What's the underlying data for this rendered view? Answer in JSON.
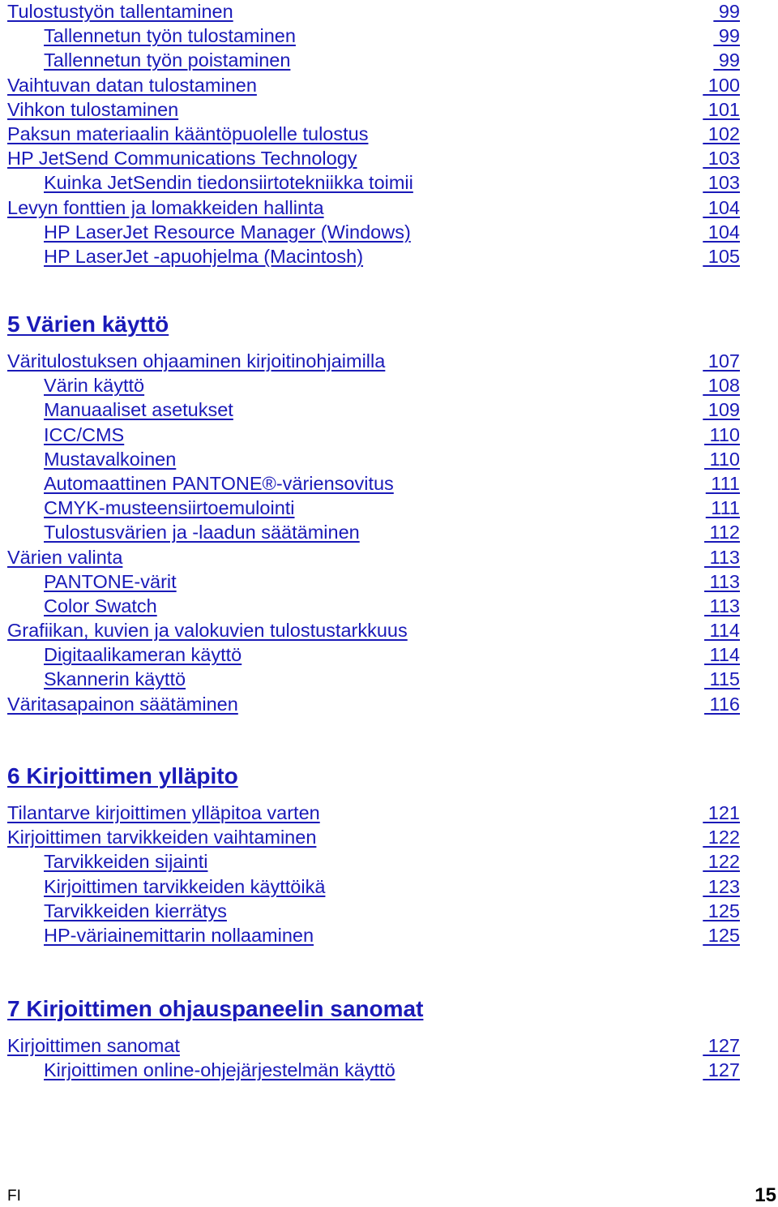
{
  "toc": {
    "sections": [
      {
        "heading": null,
        "entries": [
          {
            "level": 1,
            "title": "Tulostustyön tallentaminen",
            "page": "99"
          },
          {
            "level": 2,
            "title": "Tallennetun työn tulostaminen",
            "page": "99"
          },
          {
            "level": 2,
            "title": "Tallennetun työn poistaminen",
            "page": "99"
          },
          {
            "level": 1,
            "title": "Vaihtuvan datan tulostaminen",
            "page": "100"
          },
          {
            "level": 1,
            "title": "Vihkon tulostaminen",
            "page": "101"
          },
          {
            "level": 1,
            "title": "Paksun materiaalin kääntöpuolelle tulostus",
            "page": "102"
          },
          {
            "level": 1,
            "title": "HP JetSend Communications Technology",
            "page": "103"
          },
          {
            "level": 2,
            "title": "Kuinka JetSendin tiedonsiirtotekniikka toimii",
            "page": "103"
          },
          {
            "level": 1,
            "title": "Levyn fonttien ja lomakkeiden hallinta",
            "page": "104"
          },
          {
            "level": 2,
            "title": "HP LaserJet Resource Manager (Windows)",
            "page": "104"
          },
          {
            "level": 2,
            "title": "HP LaserJet -apuohjelma (Macintosh) ",
            "page": "105"
          }
        ]
      },
      {
        "heading": "5 Värien käyttö",
        "entries": [
          {
            "level": 1,
            "title": "Väritulostuksen ohjaaminen kirjoitinohjaimilla",
            "page": "107"
          },
          {
            "level": 2,
            "title": "Värin käyttö",
            "page": "108"
          },
          {
            "level": 2,
            "title": "Manuaaliset asetukset",
            "page": "109"
          },
          {
            "level": 2,
            "title": "ICC/CMS",
            "page": "110"
          },
          {
            "level": 2,
            "title": "Mustavalkoinen",
            "page": "110"
          },
          {
            "level": 2,
            "title": "Automaattinen PANTONE®-väriensovitus",
            "page": "111"
          },
          {
            "level": 2,
            "title": "CMYK-musteensiirtoemulointi",
            "page": "111"
          },
          {
            "level": 2,
            "title": "Tulostusvärien ja -laadun säätäminen",
            "page": "112"
          },
          {
            "level": 1,
            "title": "Värien valinta",
            "page": "113"
          },
          {
            "level": 2,
            "title": "PANTONE-värit",
            "page": "113"
          },
          {
            "level": 2,
            "title": "Color Swatch",
            "page": "113"
          },
          {
            "level": 1,
            "title": "Grafiikan, kuvien ja valokuvien tulostustarkkuus",
            "page": "114"
          },
          {
            "level": 2,
            "title": "Digitaalikameran käyttö",
            "page": "114"
          },
          {
            "level": 2,
            "title": "Skannerin käyttö",
            "page": "115"
          },
          {
            "level": 1,
            "title": "Väritasapainon säätäminen",
            "page": "116"
          }
        ]
      },
      {
        "heading": "6 Kirjoittimen ylläpito",
        "entries": [
          {
            "level": 1,
            "title": "Tilantarve kirjoittimen ylläpitoa varten",
            "page": "121"
          },
          {
            "level": 1,
            "title": "Kirjoittimen tarvikkeiden vaihtaminen",
            "page": "122"
          },
          {
            "level": 2,
            "title": "Tarvikkeiden sijainti",
            "page": "122"
          },
          {
            "level": 2,
            "title": "Kirjoittimen tarvikkeiden käyttöikä",
            "page": "123"
          },
          {
            "level": 2,
            "title": "Tarvikkeiden kierrätys",
            "page": "125"
          },
          {
            "level": 2,
            "title": "HP-väriainemittarin nollaaminen",
            "page": "125"
          }
        ]
      },
      {
        "heading": "7 Kirjoittimen ohjauspaneelin sanomat",
        "entries": [
          {
            "level": 1,
            "title": "Kirjoittimen sanomat",
            "page": "127"
          },
          {
            "level": 2,
            "title": "Kirjoittimen online-ohjejärjestelmän käyttö ",
            "page": "127"
          }
        ]
      }
    ]
  },
  "footer": {
    "language": "FI",
    "page_number": "15"
  },
  "colors": {
    "link": "#1a1ab8",
    "footer_text": "#000000",
    "background": "#ffffff"
  }
}
